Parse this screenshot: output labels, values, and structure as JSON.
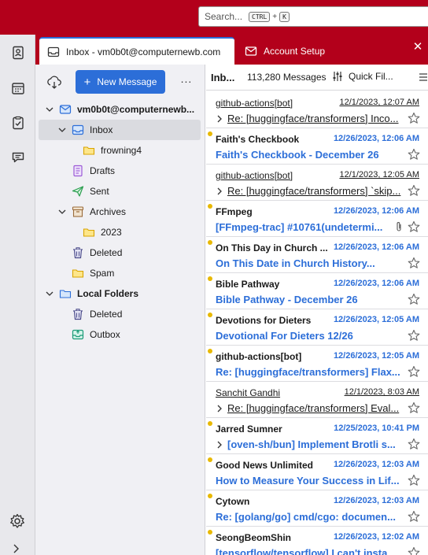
{
  "search": {
    "placeholder": "Search...",
    "shortcut_mod": "CTRL",
    "shortcut_plus": "+",
    "shortcut_key": "K"
  },
  "tabs": [
    {
      "label": "Inbox - vm0b0t@computernewb.com",
      "active": true
    },
    {
      "label": "Account Setup",
      "active": false
    }
  ],
  "folderpane": {
    "new_message_plus": "+",
    "new_message_label": "New Message",
    "more_label": "...",
    "folders": [
      {
        "label": "vm0b0t@computernewb...",
        "icon": "account-icon",
        "level": 0,
        "twisty": "open",
        "bold": true
      },
      {
        "label": "Inbox",
        "icon": "inbox-icon",
        "level": 1,
        "twisty": "open",
        "selected": true
      },
      {
        "label": "frowning4",
        "icon": "folder-icon",
        "level": 2
      },
      {
        "label": "Drafts",
        "icon": "drafts-icon",
        "level": 1
      },
      {
        "label": "Sent",
        "icon": "sent-icon",
        "level": 1
      },
      {
        "label": "Archives",
        "icon": "archive-icon",
        "level": 1,
        "twisty": "open"
      },
      {
        "label": "2023",
        "icon": "folder-icon",
        "level": 2
      },
      {
        "label": "Deleted",
        "icon": "trash-icon",
        "level": 1
      },
      {
        "label": "Spam",
        "icon": "folder-icon",
        "level": 1
      },
      {
        "label": "Local Folders",
        "icon": "local-folders-icon",
        "level": 0,
        "twisty": "open",
        "bold": true
      },
      {
        "label": "Deleted",
        "icon": "trash-icon",
        "level": 1
      },
      {
        "label": "Outbox",
        "icon": "outbox-icon",
        "level": 1
      }
    ]
  },
  "listhead": {
    "folder": "Inb...",
    "count": "113,280 Messages",
    "quick_filter": "Quick Fil..."
  },
  "messages": [
    {
      "sender": "github-actions[bot]",
      "date": "12/1/2023, 12:07 AM",
      "subject": "Re: [huggingface/transformers] Inco...",
      "unread": false,
      "thread": true
    },
    {
      "sender": "Faith's Checkbook",
      "date": "12/26/2023, 12:06 AM",
      "subject": "Faith's Checkbook - December 26",
      "unread": true,
      "thread": false
    },
    {
      "sender": "github-actions[bot]",
      "date": "12/1/2023, 12:05 AM",
      "subject": "Re: [huggingface/transformers] `skip...",
      "unread": false,
      "thread": true
    },
    {
      "sender": "FFmpeg",
      "date": "12/26/2023, 12:06 AM",
      "subject": "[FFmpeg-trac] #10761(undetermi...",
      "unread": true,
      "thread": false,
      "attachment": true
    },
    {
      "sender": "On This Day in Church ...",
      "date": "12/26/2023, 12:06 AM",
      "subject": "On This Date in Church History...",
      "unread": true,
      "thread": false
    },
    {
      "sender": "Bible Pathway",
      "date": "12/26/2023, 12:06 AM",
      "subject": "Bible Pathway - December 26",
      "unread": true,
      "thread": false
    },
    {
      "sender": "Devotions for Dieters",
      "date": "12/26/2023, 12:05 AM",
      "subject": "Devotional For Dieters 12/26",
      "unread": true,
      "thread": false
    },
    {
      "sender": "github-actions[bot]",
      "date": "12/26/2023, 12:05 AM",
      "subject": "Re: [huggingface/transformers] Flax...",
      "unread": true,
      "thread": false
    },
    {
      "sender": "Sanchit Gandhi",
      "date": "12/1/2023, 8:03 AM",
      "subject": "Re: [huggingface/transformers] Eval...",
      "unread": false,
      "thread": true
    },
    {
      "sender": "Jarred Sumner",
      "date": "12/25/2023, 10:41 PM",
      "subject": "[oven-sh/bun] Implement Brotli s...",
      "unread": true,
      "thread": true
    },
    {
      "sender": "Good News Unlimited",
      "date": "12/26/2023, 12:03 AM",
      "subject": "How to Measure Your Success in Lif...",
      "unread": true,
      "thread": false
    },
    {
      "sender": "Cytown",
      "date": "12/26/2023, 12:03 AM",
      "subject": "Re: [golang/go] cmd/cgo: documen...",
      "unread": true,
      "thread": false
    },
    {
      "sender": "SeongBeomShin",
      "date": "12/26/2023, 12:02 AM",
      "subject": "[tensorflow/tensorflow] I can't insta...",
      "unread": true,
      "thread": false
    }
  ],
  "colors": {
    "titlebar": "#b3001b",
    "accent": "#2c6ed8",
    "unread_dot": "#e8b800"
  }
}
